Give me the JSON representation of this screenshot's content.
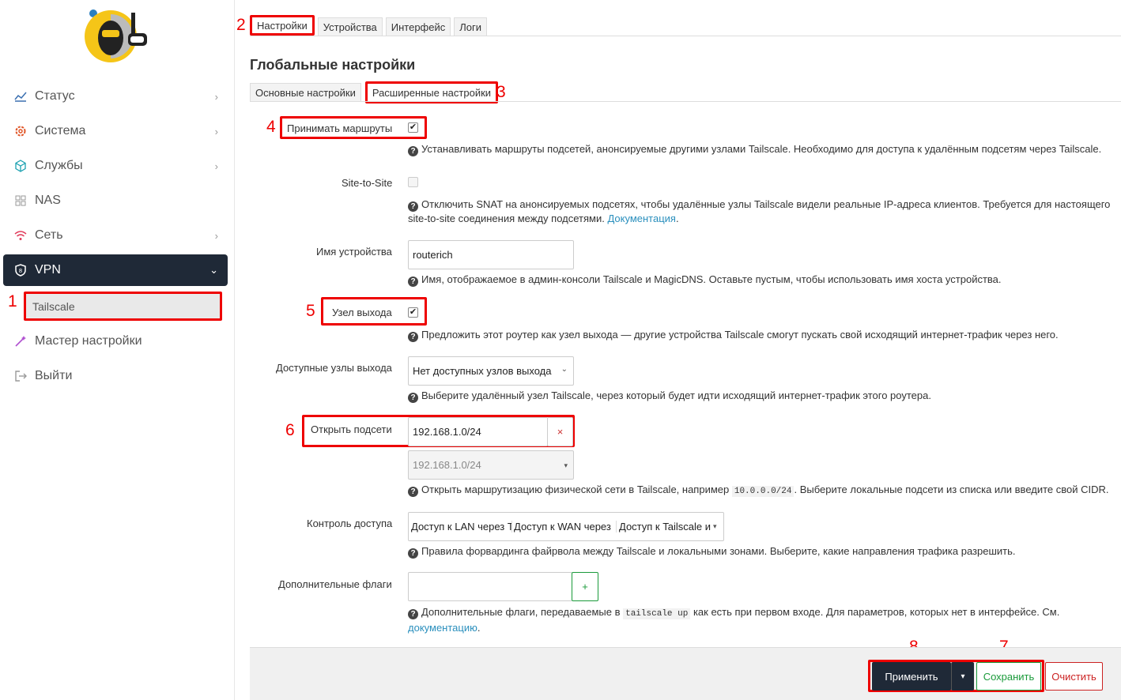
{
  "sidebar": {
    "items": [
      {
        "label": "Статус",
        "icon": "chart-icon"
      },
      {
        "label": "Система",
        "icon": "gear-icon"
      },
      {
        "label": "Службы",
        "icon": "cube-icon"
      },
      {
        "label": "NAS",
        "icon": "grid-icon"
      },
      {
        "label": "Сеть",
        "icon": "wifi-icon"
      },
      {
        "label": "VPN",
        "icon": "shield-icon"
      },
      {
        "label": "Мастер настройки",
        "icon": "wand-icon"
      },
      {
        "label": "Выйти",
        "icon": "logout-icon"
      }
    ],
    "sub_item": "Tailscale"
  },
  "annotations": [
    "1",
    "2",
    "3",
    "4",
    "5",
    "6",
    "7",
    "8"
  ],
  "tabs": [
    "Настройки",
    "Устройства",
    "Интерфейс",
    "Логи"
  ],
  "section_title": "Глобальные настройки",
  "subtabs": [
    "Основные настройки",
    "Расширенные настройки"
  ],
  "fields": {
    "accept_routes": {
      "label": "Принимать маршруты",
      "checked": true,
      "help": "Устанавливать маршруты подсетей, анонсируемые другими узлами Tailscale. Необходимо для доступа к удалённым подсетям через Tailscale."
    },
    "site_to_site": {
      "label": "Site-to-Site",
      "checked": false,
      "help_line1": "Отключить SNAT на анонсируемых подсетях, чтобы удалённые узлы Tailscale видели реальные IP-адреса клиентов. Требуется для настоящего",
      "help_line2": "site-to-site соединения между подсетями.",
      "help_link": "Документация"
    },
    "hostname": {
      "label": "Имя устройства",
      "value": "routerich",
      "help": "Имя, отображаемое в админ-консоли Tailscale и MagicDNS. Оставьте пустым, чтобы использовать имя хоста устройства."
    },
    "exit_node": {
      "label": "Узел выхода",
      "checked": true,
      "help": "Предложить этот роутер как узел выхода — другие устройства Tailscale смогут пускать свой исходящий интернет-трафик через него."
    },
    "available_exit": {
      "label": "Доступные узлы выхода",
      "value": "Нет доступных узлов выхода",
      "help": "Выберите удалённый узел Tailscale, через который будет идти исходящий интернет-трафик этого роутера."
    },
    "subnets": {
      "label": "Открыть подсети",
      "value": "192.168.1.0/24",
      "remove": "×",
      "select_value": "192.168.1.0/24",
      "help_pre": "Открыть маршрутизацию физической сети в Tailscale, например",
      "help_code": "10.0.0.0/24",
      "help_post": ". Выберите локальные подсети из списка или введите свой CIDR."
    },
    "access": {
      "label": "Контроль доступа",
      "options": [
        "Доступ к LAN через T",
        "Доступ к WAN через",
        "Доступ к Tailscale и"
      ],
      "help": "Правила форвардинга файрвола между Tailscale и локальными зонами. Выберите, какие направления трафика разрешить."
    },
    "flags": {
      "label": "Дополнительные флаги",
      "value": "",
      "add": "+",
      "help_pre": "Дополнительные флаги, передаваемые в",
      "help_code": "tailscale up",
      "help_post": "как есть при первом входе. Для параметров, которых нет в интерфейсе. См.",
      "help_link": "документацию",
      "help_end": "."
    }
  },
  "buttons": {
    "apply": "Применить",
    "apply_menu": "▾",
    "save": "Сохранить",
    "reset": "Очистить"
  },
  "colors": {
    "accent_red": "#e00000",
    "dark": "#1f2937",
    "link": "#2a8fbd",
    "save_green": "#1a9a3a",
    "reset_red": "#cc2222"
  }
}
